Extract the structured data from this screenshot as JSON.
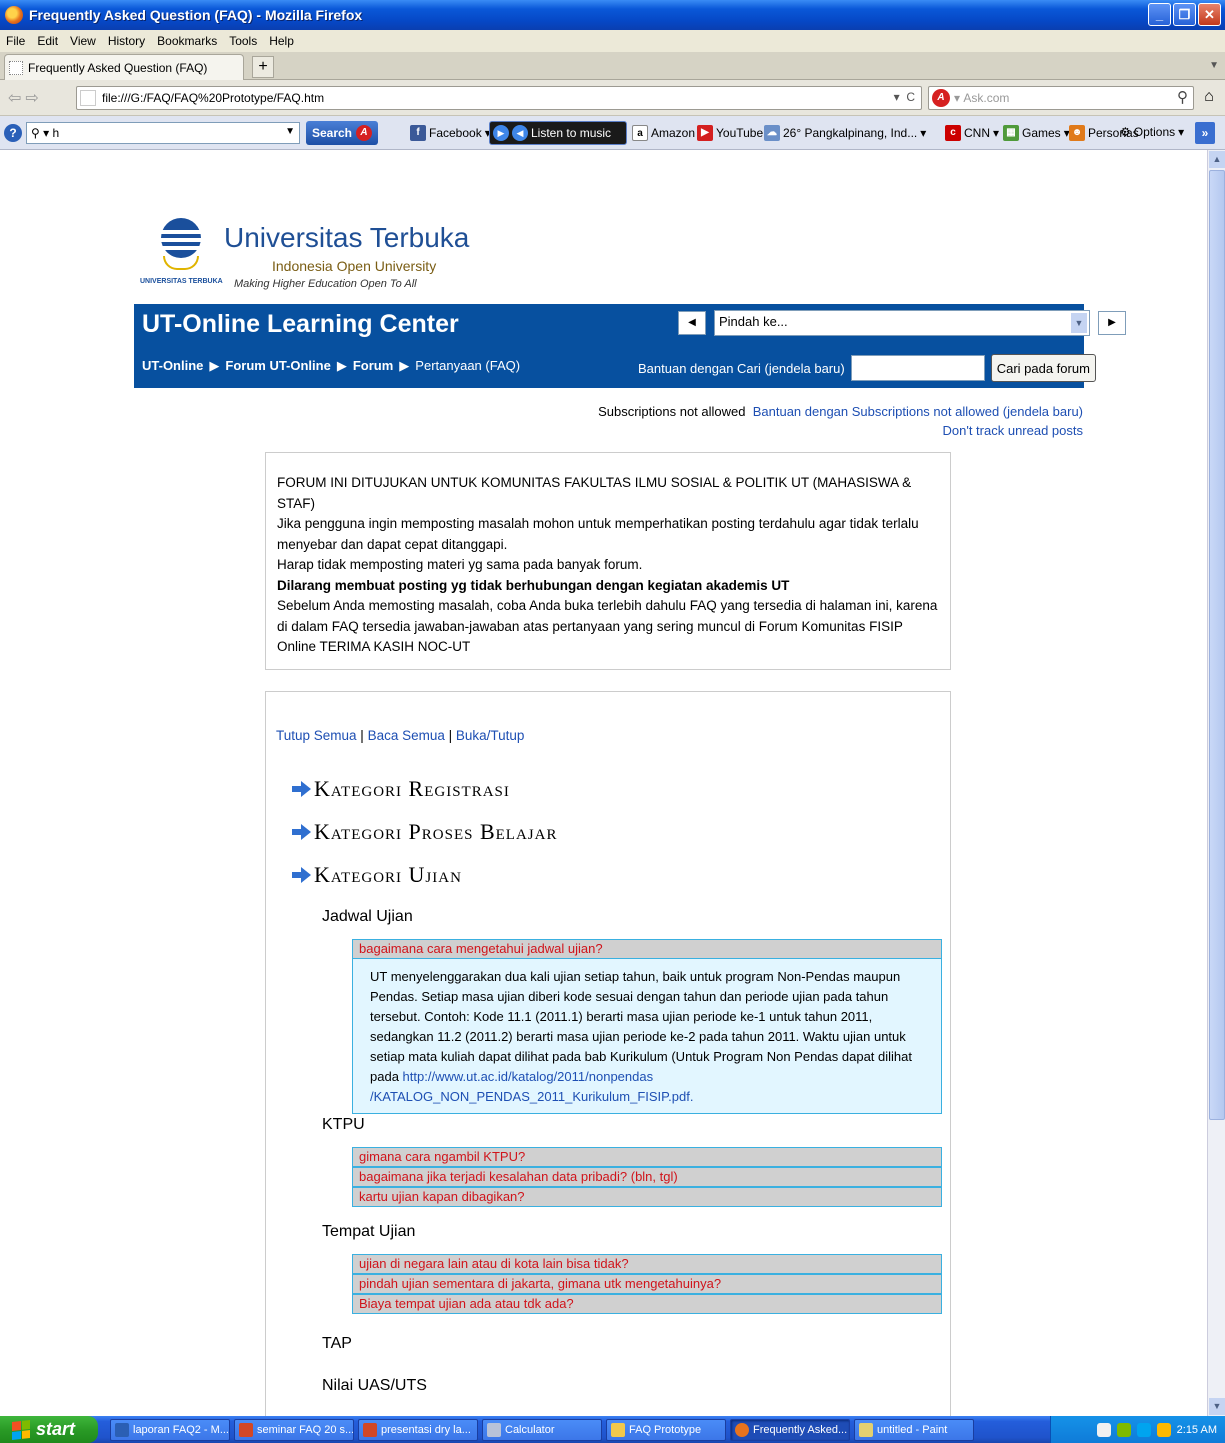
{
  "window": {
    "title": "Frequently Asked Question (FAQ) - Mozilla Firefox"
  },
  "menu": [
    "File",
    "Edit",
    "View",
    "History",
    "Bookmarks",
    "Tools",
    "Help"
  ],
  "tab": {
    "label": "Frequently Asked Question (FAQ)",
    "new_tab": "+"
  },
  "nav": {
    "url": "file:///G:/FAQ/FAQ%20Prototype/FAQ.htm",
    "search_placeholder": "Ask.com"
  },
  "ask_toolbar": {
    "input_value": "h",
    "search_label": "Search",
    "items": [
      "Facebook",
      "Listen to music",
      "Amazon",
      "YouTube",
      "26° Pangkalpinang, Ind...",
      "CNN",
      "Games",
      "Personas",
      "Options"
    ]
  },
  "site": {
    "name": "Universitas Terbuka",
    "subtitle": "Indonesia Open University",
    "motto": "Making Higher Education Open To All",
    "emblem_text": "UNIVERSITAS TERBUKA"
  },
  "header": {
    "title": "UT-Online Learning Center",
    "breadcrumb": [
      "UT-Online",
      "Forum UT-Online",
      "Forum",
      "Pertanyaan (FAQ)"
    ],
    "jump_label": "Pindah ke...",
    "search_help": "Bantuan dengan Cari (jendela baru)",
    "search_button": "Cari pada forum"
  },
  "subscriptions": {
    "status": "Subscriptions not allowed",
    "help_link": "Bantuan dengan Subscriptions not allowed (jendela baru)",
    "track_link": "Don't track unread posts"
  },
  "notice": {
    "line1": "FORUM INI DITUJUKAN UNTUK KOMUNITAS FAKULTAS ILMU SOSIAL & POLITIK UT (MAHASISWA & STAF)",
    "line2": "Jika pengguna ingin memposting masalah mohon untuk memperhatikan posting terdahulu agar tidak terlalu menyebar dan dapat cepat ditanggapi.",
    "line3": "Harap tidak memposting materi yg sama pada banyak forum.",
    "line4": "Dilarang membuat posting yg tidak berhubungan dengan kegiatan akademis UT",
    "line5": "Sebelum Anda memosting masalah, coba Anda buka terlebih dahulu FAQ yang tersedia di halaman ini, karena di dalam FAQ tersedia jawaban-jawaban atas pertanyaan yang sering muncul di Forum Komunitas FISIP Online TERIMA KASIH NOC-UT"
  },
  "faq": {
    "controls": [
      "Tutup Semua",
      "Baca Semua",
      "Buka/Tutup"
    ],
    "categories": [
      "Kategori Registrasi",
      "Kategori Proses Belajar",
      "Kategori Ujian"
    ],
    "sections": {
      "jadwal": "Jadwal Ujian",
      "ktpu": "KTPU",
      "tempat": "Tempat Ujian",
      "tap": "TAP",
      "nilai": "Nilai UAS/UTS"
    },
    "jadwal_q": "bagaimana cara mengetahui jadwal ujian?",
    "jadwal_a": "UT menyelenggarakan dua kali ujian setiap tahun, baik untuk program Non-Pendas maupun Pendas. Setiap masa ujian diberi kode sesuai dengan tahun dan periode ujian pada tahun tersebut. Contoh: Kode 11.1 (2011.1) berarti masa ujian periode ke-1 untuk tahun 2011, sedangkan 11.2 (2011.2) berarti masa ujian periode ke-2 pada tahun 2011. Waktu ujian untuk setiap mata kuliah dapat dilihat pada bab Kurikulum (Untuk Program Non Pendas dapat dilihat pada",
    "jadwal_link": "http://www.ut.ac.id/katalog/2011/nonpendas /KATALOG_NON_PENDAS_2011_Kurikulum_FISIP.pdf.",
    "ktpu_q": [
      "gimana cara ngambil KTPU?",
      "bagaimana jika terjadi kesalahan data pribadi? (bln, tgl)",
      "kartu ujian kapan dibagikan?"
    ],
    "tempat_q": [
      "ujian di negara lain atau di kota lain bisa tidak?",
      "pindah ujian sementara di jakarta, gimana utk mengetahuinya?",
      "Biaya tempat ujian ada atau tdk ada?"
    ]
  },
  "taskbar": {
    "start": "start",
    "tasks": [
      "laporan FAQ2 - M...",
      "seminar FAQ 20 s...",
      "presentasi dry la...",
      "Calculator",
      "FAQ Prototype",
      "Frequently Asked...",
      "untitled - Paint"
    ],
    "clock": "2:15 AM"
  }
}
